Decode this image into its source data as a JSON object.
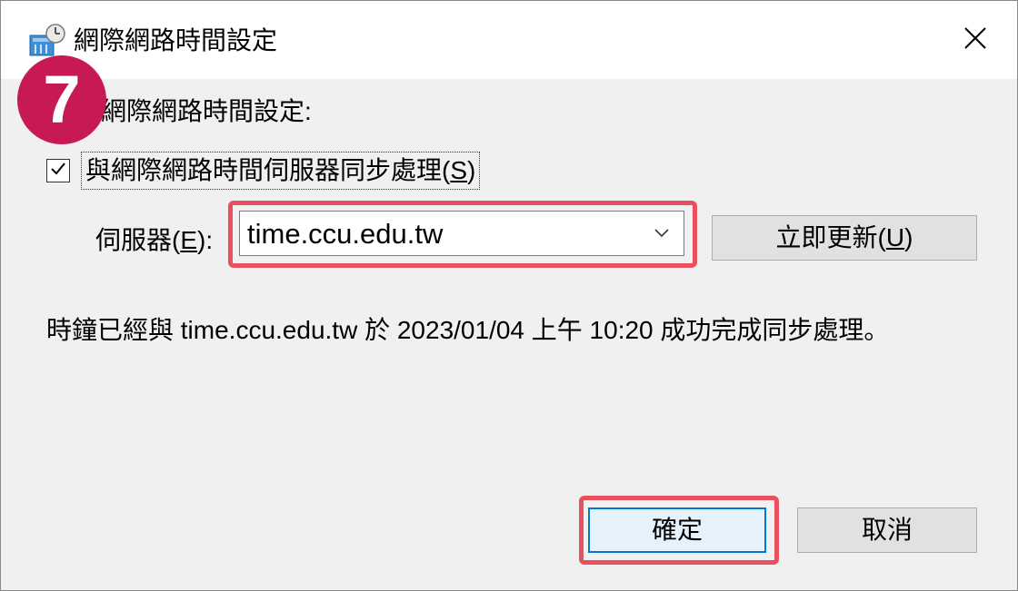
{
  "window": {
    "title": "網際網路時間設定",
    "icon": "network-clock-icon",
    "close_glyph": "✕"
  },
  "step_badge": {
    "number": "7",
    "color": "#c71a54"
  },
  "section_label": "網際網路時間設定:",
  "sync_option": {
    "checked": true,
    "label": "與網際網路時間伺服器同步處理(",
    "accel": "S",
    "label_end": ")"
  },
  "server": {
    "label": "伺服器(",
    "accel": "E",
    "label_end": "):",
    "value": "time.ccu.edu.tw",
    "highlight_color": "#e8505e"
  },
  "update_button": {
    "label": "立即更新(",
    "accel": "U",
    "label_end": ")"
  },
  "status_message": "時鐘已經與 time.ccu.edu.tw 於 2023/01/04 上午 10:20 成功完成同步處理。",
  "buttons": {
    "ok": "確定",
    "cancel": "取消"
  },
  "colors": {
    "accent": "#0078d7",
    "highlight": "#e8505e",
    "badge": "#c71a54"
  }
}
